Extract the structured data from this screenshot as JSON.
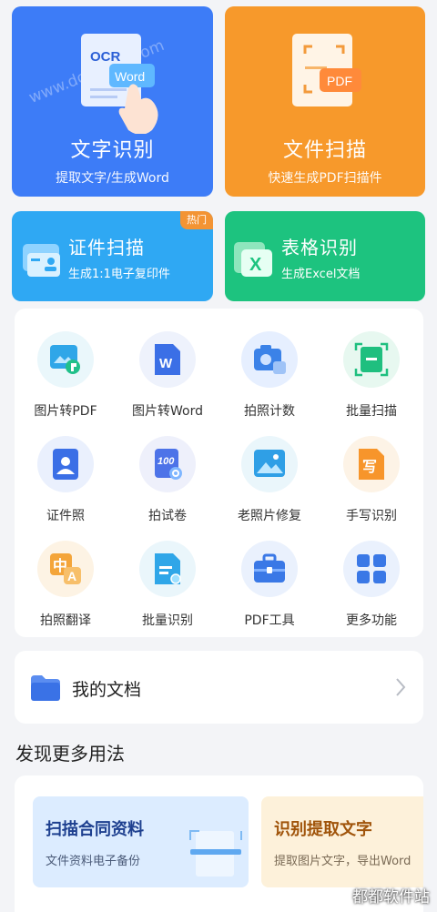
{
  "cards": {
    "ocr": {
      "title": "文字识别",
      "subtitle": "提取文字/生成Word",
      "doc_label": "OCR",
      "word_label": "Word",
      "watermark": "www.downxia.com"
    },
    "scan": {
      "title": "文件扫描",
      "subtitle": "快速生成PDF扫描件",
      "pdf_label": "PDF"
    },
    "id": {
      "title": "证件扫描",
      "subtitle": "生成1:1电子复印件",
      "badge": "热门"
    },
    "table": {
      "title": "表格识别",
      "subtitle": "生成Excel文档",
      "icon_letter": "X"
    }
  },
  "tools": [
    {
      "label": "图片转PDF",
      "icon": "image-to-pdf-icon"
    },
    {
      "label": "图片转Word",
      "icon": "image-to-word-icon"
    },
    {
      "label": "拍照计数",
      "icon": "photo-count-icon"
    },
    {
      "label": "批量扫描",
      "icon": "batch-scan-icon"
    },
    {
      "label": "证件照",
      "icon": "id-photo-icon"
    },
    {
      "label": "拍试卷",
      "icon": "exam-paper-icon"
    },
    {
      "label": "老照片修复",
      "icon": "photo-restore-icon"
    },
    {
      "label": "手写识别",
      "icon": "handwriting-icon"
    },
    {
      "label": "拍照翻译",
      "icon": "translate-icon"
    },
    {
      "label": "批量识别",
      "icon": "batch-recognize-icon"
    },
    {
      "label": "PDF工具",
      "icon": "pdf-toolbox-icon"
    },
    {
      "label": "更多功能",
      "icon": "more-grid-icon"
    }
  ],
  "tool_icon_text": {
    "word_w": "W",
    "exam_num": "100",
    "handwrite": "写",
    "translate_zh": "中",
    "translate_a": "A"
  },
  "docs": {
    "title": "我的文档"
  },
  "discover": {
    "title": "发现更多用法",
    "promos": [
      {
        "title": "扫描合同资料",
        "subtitle": "文件资料电子备份"
      },
      {
        "title": "识别提取文字",
        "subtitle": "提取图片文字，导出Word"
      }
    ]
  },
  "site_watermark": "都都软件站"
}
